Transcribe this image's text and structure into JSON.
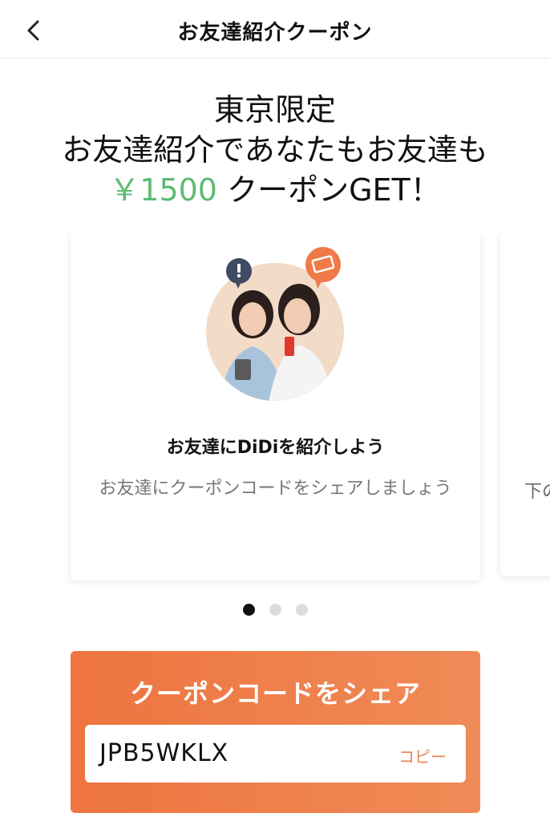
{
  "nav": {
    "title": "お友達紹介クーポン"
  },
  "headline": {
    "line1": "東京限定",
    "line2": "お友達紹介であなたもお友達も",
    "amount": "￥1500",
    "line3_suffix": " クーポンGET！"
  },
  "carousel": {
    "cards": [
      {
        "title": "お友達にDiDiを紹介しよう",
        "description": "お友達にクーポンコードをシェアしましょう"
      },
      {
        "partial_text": "下の"
      }
    ],
    "page_count": 3,
    "active_page": 1
  },
  "share": {
    "title": "クーポンコードをシェア",
    "code": "JPB5WKLX",
    "copy_label": "コピー"
  },
  "colors": {
    "accent_orange": "#ee7440",
    "amount_green": "#5dbb74",
    "copy_text": "#e9834f"
  }
}
